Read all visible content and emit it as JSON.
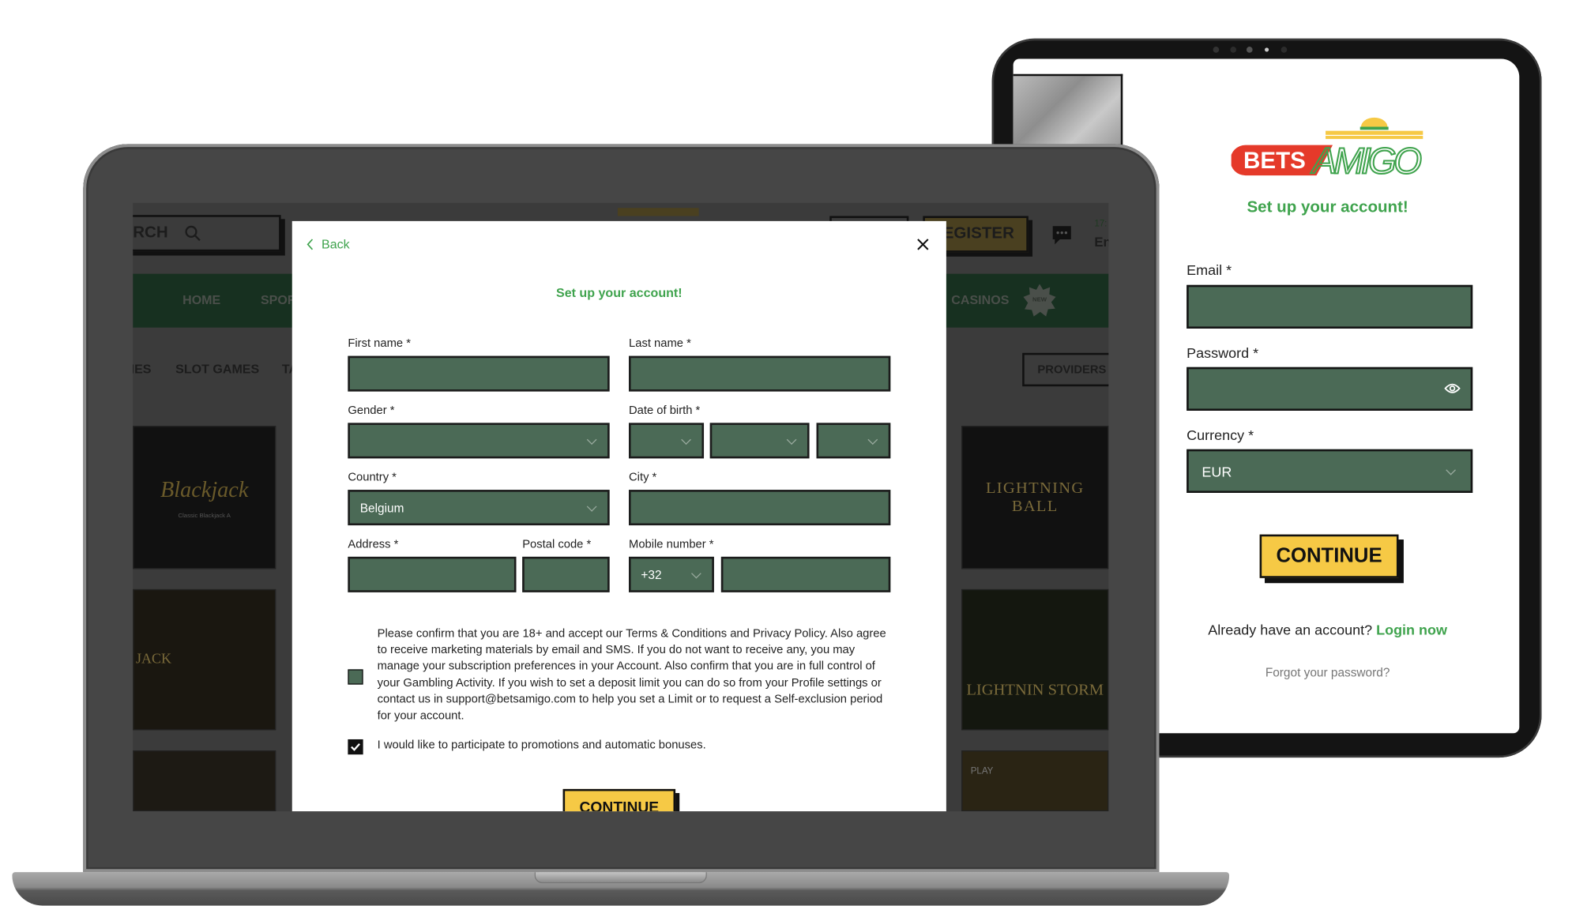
{
  "brand": {
    "logo_text_left": "BETS",
    "logo_text_right": "AMIGO",
    "colors": {
      "green": "#3fa34d",
      "red": "#e53a2a",
      "yellow": "#f6c945",
      "input_bg": "#4b6a56"
    }
  },
  "tablet": {
    "title": "Set up your account!",
    "email_label": "Email *",
    "password_label": "Password *",
    "password_icon": "eye-icon",
    "currency_label": "Currency *",
    "currency_value": "EUR",
    "continue_label": "CONTINUE",
    "login_prompt": "Already have an account?",
    "login_link": "Login now",
    "forgot_link": "Forgot your password?"
  },
  "site": {
    "search_partial": "RCH",
    "register_partial": "EGISTER",
    "time_partial": "17:",
    "lang_partial": "En",
    "nav": [
      "HOME",
      "SPOR",
      "CASINOS"
    ],
    "new_badge": "NEW",
    "subnav": [
      "IES",
      "SLOT GAMES",
      "TA"
    ],
    "providers_label": "PROVIDERS",
    "tiles_left": [
      "Blackjack",
      "Classic Blackjack A",
      "JACK",
      ""
    ],
    "tiles_right": [
      "LIGHTNING BALL",
      "LIGHTNIN STORM",
      "PLAY"
    ]
  },
  "modal": {
    "back_label": "Back",
    "title": "Set up your account!",
    "fields": {
      "first_name": "First name *",
      "last_name": "Last name *",
      "gender": "Gender *",
      "dob": "Date of birth *",
      "country": "Country *",
      "country_value": "Belgium",
      "city": "City *",
      "address": "Address *",
      "postal": "Postal code *",
      "mobile": "Mobile number *",
      "mobile_prefix": "+32"
    },
    "consent_text": "Please confirm that you are 18+ and accept our Terms & Conditions and Privacy Policy. Also agree to receive marketing materials by email and SMS. If you do not want to receive any, you may manage your subscription preferences in your Account. Also confirm that you are in full control of your Gambling Activity. If you wish to set a deposit limit you can do so from your Profile settings or contact us in support@betsamigo.com to help you set a Limit or to request a Self-exclusion period for your account.",
    "consent_checked": false,
    "promo_text": "I would like to participate to promotions and automatic bonuses.",
    "promo_checked": true,
    "continue_label": "CONTINUE"
  }
}
